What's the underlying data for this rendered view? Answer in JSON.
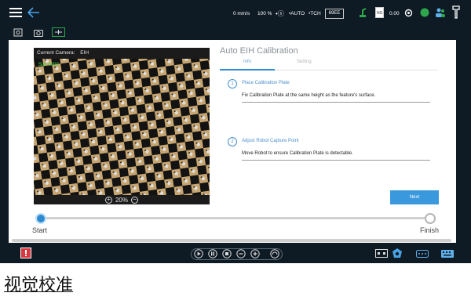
{
  "topbar": {
    "speed": "0 mm/s",
    "speed_percent": "100 %",
    "mode_auto": "AUTO",
    "mode_tch": "TCH",
    "id_box": "69EE",
    "value": "0.00"
  },
  "camera": {
    "label": "Current Camera:",
    "name": "EIH",
    "overlay_text": "Sub 0000",
    "zoom": "20%"
  },
  "calibration": {
    "title": "Auto EIH Calibration",
    "tabs": [
      {
        "label": "Info",
        "active": true
      },
      {
        "label": "Setting",
        "active": false
      }
    ],
    "steps": [
      {
        "num": "1",
        "title": "Place Calibration Plate",
        "desc": "Fix Calibration Plate at the same height as the feature's surface."
      },
      {
        "num": "2",
        "title": "Adjust Robot Capture Point",
        "desc": "Move Robot to ensure Calibration Plate is detectable."
      }
    ],
    "next_label": "Next"
  },
  "progress": {
    "start_label": "Start",
    "finish_label": "Finish"
  },
  "caption": "视觉校准",
  "colors": {
    "dark": "#0e1a24",
    "accent": "#3a98dd",
    "green": "#2ea84a"
  }
}
